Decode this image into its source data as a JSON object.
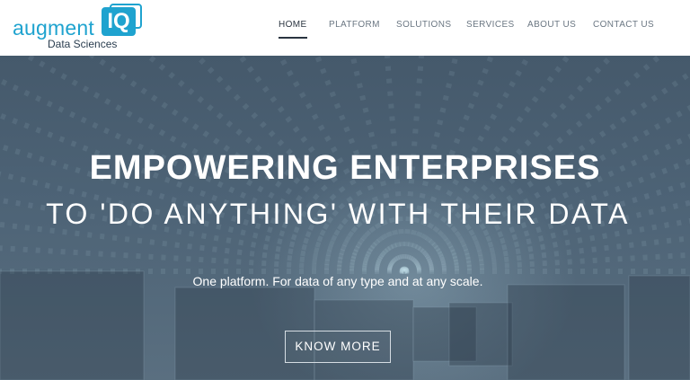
{
  "brand": {
    "name": "augment",
    "badge": "IQ",
    "subtitle": "Data Sciences",
    "accent_color": "#1fa3cf"
  },
  "nav": {
    "items": [
      {
        "label": "HOME",
        "active": true
      },
      {
        "label": "PLATFORM",
        "active": false
      },
      {
        "label": "SOLUTIONS",
        "active": false
      },
      {
        "label": "SERVICES",
        "active": false
      },
      {
        "label": "ABOUT US",
        "active": false
      },
      {
        "label": "CONTACT US",
        "active": false
      }
    ]
  },
  "hero": {
    "title": "EMPOWERING ENTERPRISES",
    "subtitle": "TO 'DO ANYTHING' WITH THEIR DATA",
    "tagline": "One platform. For data of any type and at any scale.",
    "cta_label": "KNOW MORE",
    "background_color": "#4d6376"
  }
}
